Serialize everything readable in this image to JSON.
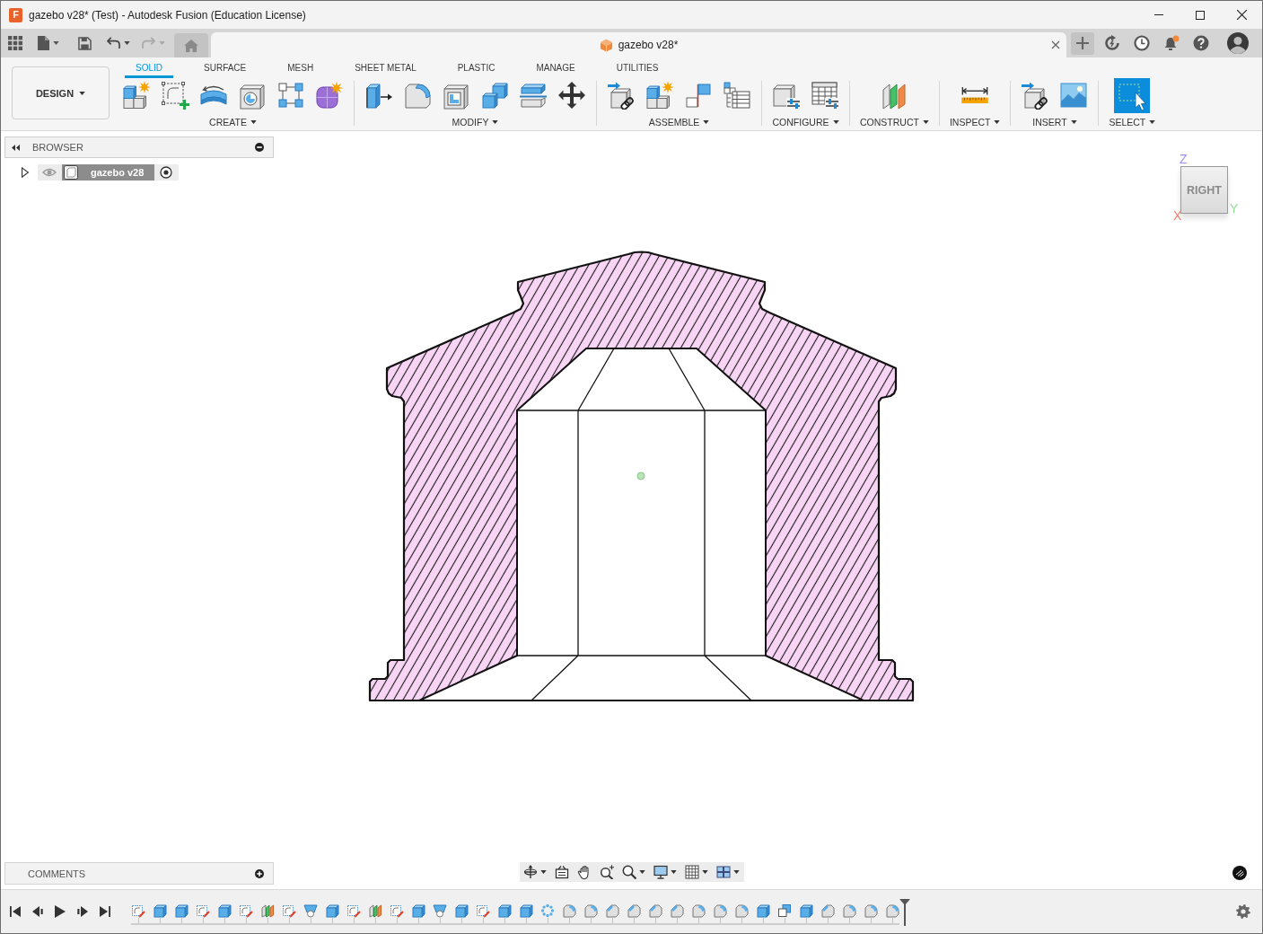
{
  "window": {
    "logo_letter": "F",
    "title": "gazebo v28* (Test) - Autodesk Fusion (Education License)"
  },
  "quick_access": {
    "undo": {
      "disabled": false
    },
    "redo": {
      "disabled": true
    }
  },
  "document_tab": {
    "title": "gazebo v28*"
  },
  "toolbar": {
    "workspace": "DESIGN",
    "tabs": [
      {
        "label": "SOLID",
        "selected": true
      },
      {
        "label": "SURFACE",
        "selected": false
      },
      {
        "label": "MESH",
        "selected": false
      },
      {
        "label": "SHEET METAL",
        "selected": false
      },
      {
        "label": "PLASTIC",
        "selected": false
      },
      {
        "label": "MANAGE",
        "selected": false
      },
      {
        "label": "UTILITIES",
        "selected": false
      }
    ],
    "groups": [
      {
        "label": "CREATE",
        "tools": [
          {
            "kind": "component"
          },
          {
            "kind": "sketch"
          },
          {
            "kind": "revolve"
          },
          {
            "kind": "hole"
          },
          {
            "kind": "pattern"
          },
          {
            "kind": "form"
          }
        ]
      },
      {
        "label": "MODIFY",
        "tools": [
          {
            "kind": "presspull"
          },
          {
            "kind": "fillet"
          },
          {
            "kind": "shell"
          },
          {
            "kind": "combine"
          },
          {
            "kind": "split"
          },
          {
            "kind": "move"
          }
        ]
      },
      {
        "label": "ASSEMBLE",
        "tools": [
          {
            "kind": "joint"
          },
          {
            "kind": "component"
          },
          {
            "kind": "flag"
          },
          {
            "kind": "bom"
          }
        ]
      },
      {
        "label": "CONFIGURE",
        "tools": [
          {
            "kind": "configure"
          },
          {
            "kind": "configtable"
          }
        ]
      },
      {
        "label": "CONSTRUCT",
        "tools": [
          {
            "kind": "plane"
          }
        ]
      },
      {
        "label": "INSPECT",
        "tools": [
          {
            "kind": "measure"
          }
        ]
      },
      {
        "label": "INSERT",
        "tools": [
          {
            "kind": "joint"
          },
          {
            "kind": "image"
          }
        ]
      },
      {
        "label": "SELECT",
        "tools": [
          {
            "kind": "select"
          }
        ]
      }
    ]
  },
  "browser": {
    "title": "BROWSER",
    "items": [
      {
        "label": "gazebo v28",
        "expanded": false,
        "visible": true
      }
    ]
  },
  "view_cube": {
    "face": "RIGHT",
    "axes": [
      {
        "label": "Z",
        "color": "#a08cf0"
      },
      {
        "label": "Y",
        "color": "#8fe08f"
      },
      {
        "label": "X",
        "color": "#f07f6c"
      }
    ]
  },
  "comments": {
    "title": "COMMENTS"
  },
  "timeline": {
    "features": [
      {
        "kind": "sketch"
      },
      {
        "kind": "extrude"
      },
      {
        "kind": "extrude"
      },
      {
        "kind": "sketch"
      },
      {
        "kind": "extrude"
      },
      {
        "kind": "sketch"
      },
      {
        "kind": "plane"
      },
      {
        "kind": "sketch"
      },
      {
        "kind": "hole"
      },
      {
        "kind": "extrude"
      },
      {
        "kind": "sketch"
      },
      {
        "kind": "plane"
      },
      {
        "kind": "sketch"
      },
      {
        "kind": "extrude"
      },
      {
        "kind": "hole"
      },
      {
        "kind": "extrude"
      },
      {
        "kind": "sketch"
      },
      {
        "kind": "extrude"
      },
      {
        "kind": "extrude"
      },
      {
        "kind": "pattern"
      },
      {
        "kind": "fillet"
      },
      {
        "kind": "fillet"
      },
      {
        "kind": "chamfer"
      },
      {
        "kind": "chamfer"
      },
      {
        "kind": "chamfer"
      },
      {
        "kind": "chamfer"
      },
      {
        "kind": "fillet"
      },
      {
        "kind": "fillet"
      },
      {
        "kind": "fillet"
      },
      {
        "kind": "extrude"
      },
      {
        "kind": "combine"
      },
      {
        "kind": "extrude"
      },
      {
        "kind": "chamfer"
      },
      {
        "kind": "fillet"
      },
      {
        "kind": "fillet"
      },
      {
        "kind": "fillet"
      }
    ]
  }
}
